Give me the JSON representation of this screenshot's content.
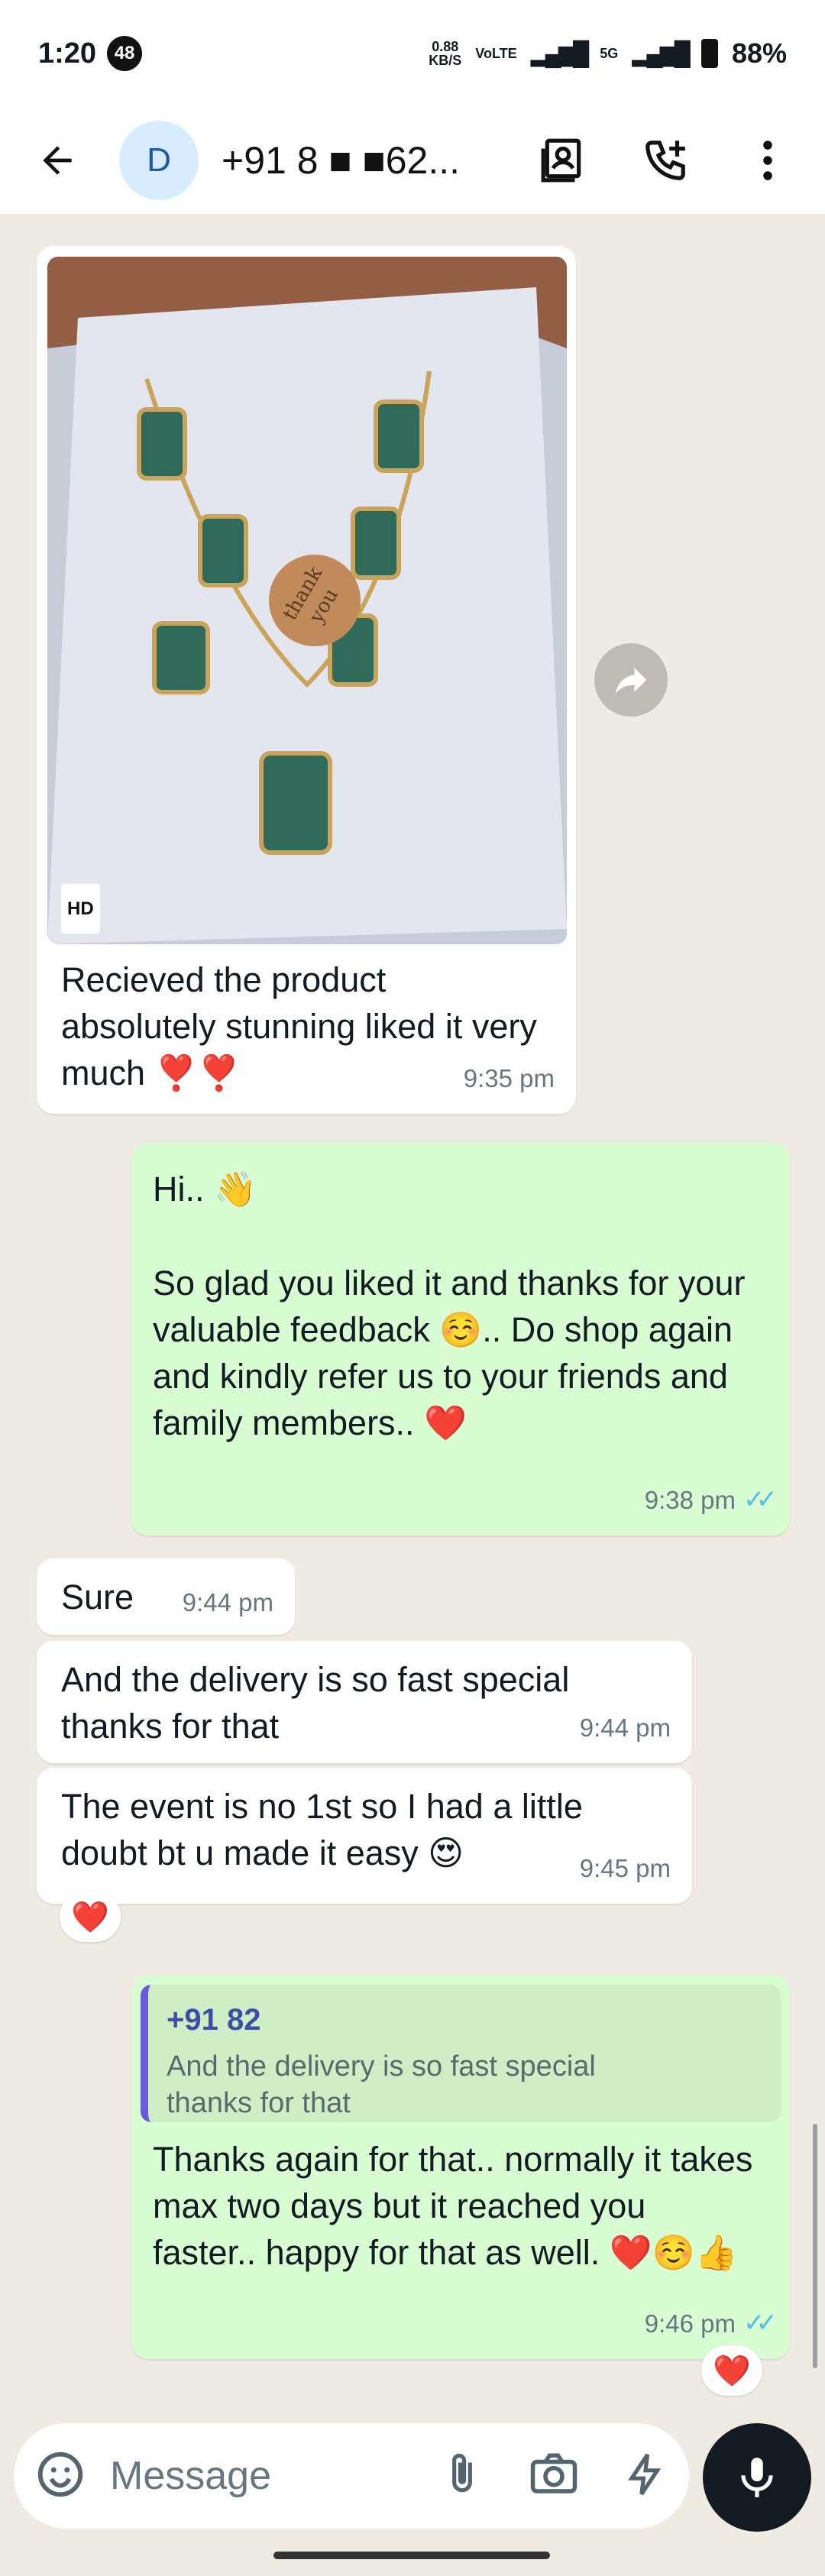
{
  "status_bar": {
    "time": "1:20",
    "notification_count": "48",
    "net_speed": "0.88",
    "net_unit": "KB/S",
    "volte": "VoLTE",
    "network": "5G",
    "battery": "88%"
  },
  "header": {
    "avatar_letter": "D",
    "contact_name": "+91 8 ■ ■62..."
  },
  "messages": [
    {
      "direction": "incoming",
      "has_image": true,
      "image_badge": "HD",
      "text": "Recieved the product absolutely stunning liked it very much ❣️❣️",
      "time": "9:35 pm"
    },
    {
      "direction": "outgoing",
      "text_line1": "Hi.. 👋",
      "text": "So glad you liked it and thanks for your valuable feedback ☺️.. Do shop again and kindly refer us to your friends and family members.. ❤️",
      "time": "9:38 pm",
      "status": "read"
    },
    {
      "direction": "incoming",
      "text": "Sure",
      "time": "9:44 pm"
    },
    {
      "direction": "incoming",
      "text": "And the delivery is so fast special thanks for that",
      "time": "9:44 pm"
    },
    {
      "direction": "incoming",
      "text": "The event is no 1st so I had a little doubt bt u made it easy 😍",
      "time": "9:45 pm",
      "reaction": "❤️"
    },
    {
      "direction": "outgoing",
      "quote_author": "+91 82",
      "quote_text": "And the delivery is so fast special thanks for that",
      "text": "Thanks again for that.. normally it takes max two days but it reached you faster.. happy for that as well. ❤️☺️👍",
      "time": "9:46 pm",
      "status": "read",
      "reaction": "❤️"
    }
  ],
  "composer": {
    "placeholder": "Message"
  },
  "colors": {
    "incoming_bubble": "#ffffff",
    "outgoing_bubble": "#d9fdd3",
    "chat_background": "#efeae2",
    "read_ticks": "#53bdeb"
  }
}
